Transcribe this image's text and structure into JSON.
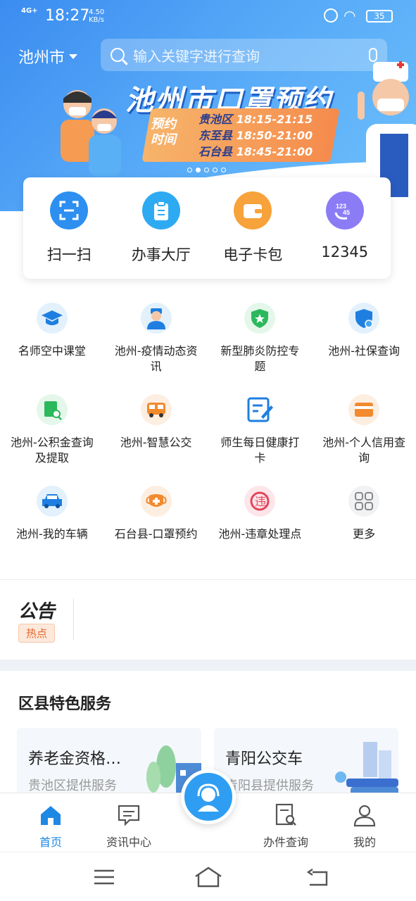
{
  "status_bar": {
    "signal": "4G+",
    "time": "18:27",
    "speed_value": "4.50",
    "speed_unit": "KB/s",
    "battery": "35"
  },
  "header": {
    "city": "池州市",
    "search_placeholder": "输入关键字进行查询"
  },
  "banner": {
    "title": "池州市口罩预约",
    "label": "预约时间",
    "rows": [
      {
        "district": "贵池区",
        "time": "18:15-21:15"
      },
      {
        "district": "东至县",
        "time": "18:50-21:00"
      },
      {
        "district": "石台县",
        "time": "18:45-21:00"
      }
    ],
    "slides": 5,
    "active_slide": 2
  },
  "quick": [
    {
      "label": "扫一扫",
      "icon": "scan-icon",
      "color": "#2d8ff0"
    },
    {
      "label": "办事大厅",
      "icon": "clipboard-icon",
      "color": "#2eaaf2"
    },
    {
      "label": "电子卡包",
      "icon": "wallet-icon",
      "color": "#f7a23a"
    },
    {
      "label": "12345",
      "icon": "hotline-12345-icon",
      "color": "#8b7cf6"
    }
  ],
  "services": [
    {
      "label": "名师空中课堂",
      "icon": "graduation-cap-icon"
    },
    {
      "label": "池州-疫情动态资讯",
      "icon": "doctor-icon"
    },
    {
      "label": "新型肺炎防控专题",
      "icon": "shield-star-icon"
    },
    {
      "label": "池州-社保查询",
      "icon": "social-security-shield-icon"
    },
    {
      "label": "池州-公积金查询及提取",
      "icon": "fund-search-icon"
    },
    {
      "label": "池州-智慧公交",
      "icon": "bus-icon"
    },
    {
      "label": "师生每日健康打卡",
      "icon": "edit-form-icon"
    },
    {
      "label": "池州-个人信用查询",
      "icon": "card-icon"
    },
    {
      "label": "池州-我的车辆",
      "icon": "car-icon"
    },
    {
      "label": "石台县-口罩预约",
      "icon": "mask-icon"
    },
    {
      "label": "池州-违章处理点",
      "icon": "violation-icon"
    },
    {
      "label": "更多",
      "icon": "grid-more-icon"
    }
  ],
  "notice": {
    "logo": "公告",
    "tag": "热点"
  },
  "district_section": {
    "title": "区县特色服务",
    "cards": [
      {
        "title": "养老金资格…",
        "subtitle": "贵池区提供服务"
      },
      {
        "title": "青阳公交车",
        "subtitle": "青阳县提供服务"
      }
    ]
  },
  "bottom_nav": [
    {
      "label": "首页",
      "icon": "home-icon",
      "active": true
    },
    {
      "label": "资讯中心",
      "icon": "message-icon",
      "active": false
    },
    {
      "label": "办件查询",
      "icon": "document-search-icon",
      "active": false
    },
    {
      "label": "我的",
      "icon": "user-icon",
      "active": false
    }
  ],
  "colors": {
    "accent": "#1e88e5",
    "banner_start": "#3b8cf0",
    "banner_end": "#6ec0fb"
  }
}
